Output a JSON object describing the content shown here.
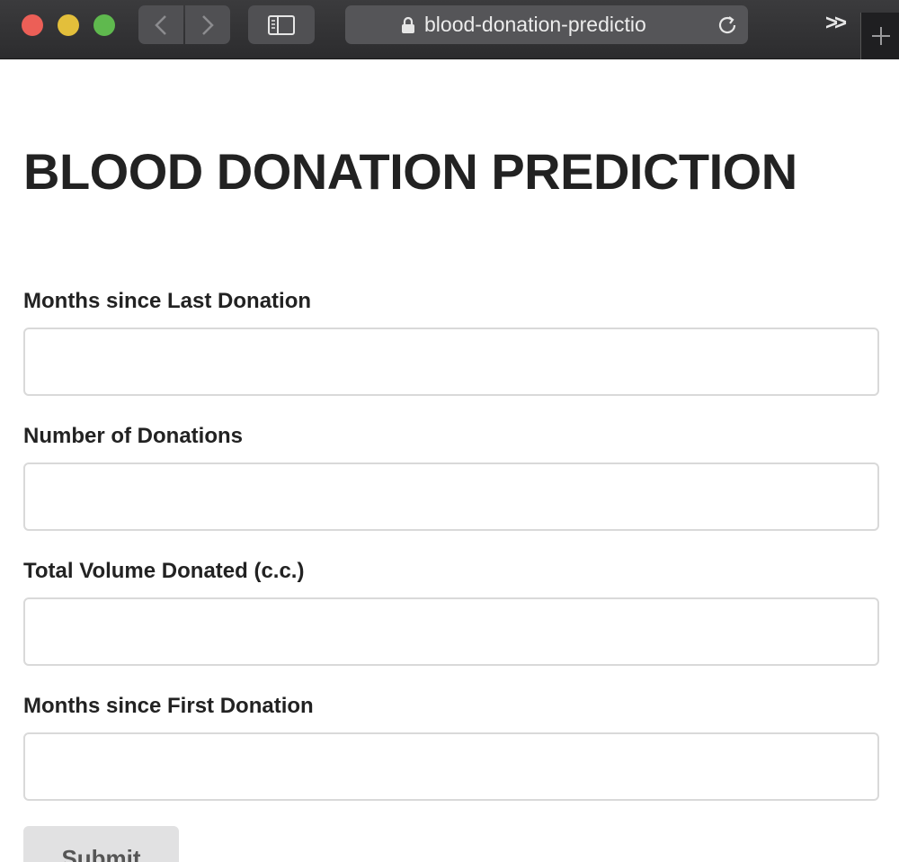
{
  "browser": {
    "url": "blood-donation-predictio",
    "icons": {
      "back": "chevron-left-icon",
      "forward": "chevron-right-icon",
      "sidebar": "sidebar-icon",
      "lock": "lock-icon",
      "reload": "reload-icon",
      "overflow": "chevron-double-right-icon",
      "new_tab": "plus-icon"
    },
    "overflow_label": ">>"
  },
  "page": {
    "title": "BLOOD DONATION PREDICTION",
    "fields": [
      {
        "label": "Months since Last Donation",
        "value": "",
        "placeholder": ""
      },
      {
        "label": "Number of Donations",
        "value": "",
        "placeholder": ""
      },
      {
        "label": "Total Volume Donated (c.c.)",
        "value": "",
        "placeholder": ""
      },
      {
        "label": "Months since First Donation",
        "value": "",
        "placeholder": ""
      }
    ],
    "submit_label": "Submit"
  },
  "colors": {
    "title_text": "#222222",
    "submit_bg": "#e1e1e2",
    "submit_text": "#555555",
    "toolbar_bg": "#2c2c2e"
  }
}
